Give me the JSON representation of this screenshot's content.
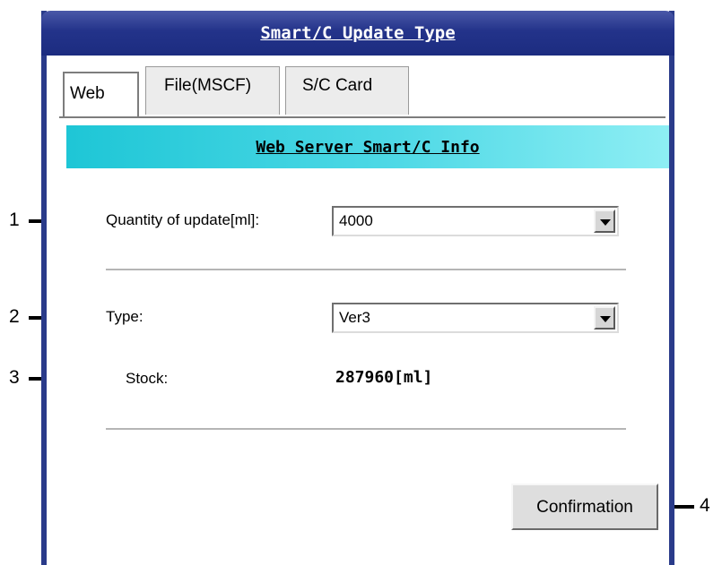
{
  "window": {
    "title": "Smart/C Update Type"
  },
  "tabs": [
    {
      "label": "Web",
      "active": true
    },
    {
      "label": "File(MSCF)",
      "active": false
    },
    {
      "label": "S/C Card",
      "active": false
    }
  ],
  "panel": {
    "header": "Web Server Smart/C Info"
  },
  "form": {
    "quantity_label": "Quantity of update[ml]:",
    "quantity_value": "4000",
    "type_label": "Type:",
    "type_value": "Ver3",
    "stock_label": "Stock:",
    "stock_value": "287960[ml]"
  },
  "buttons": {
    "confirm_label": "Confirmation"
  },
  "callouts": [
    "1",
    "2",
    "3",
    "4"
  ],
  "colors": {
    "titlebar": "#23338a",
    "banner": "#1ec6d6"
  }
}
